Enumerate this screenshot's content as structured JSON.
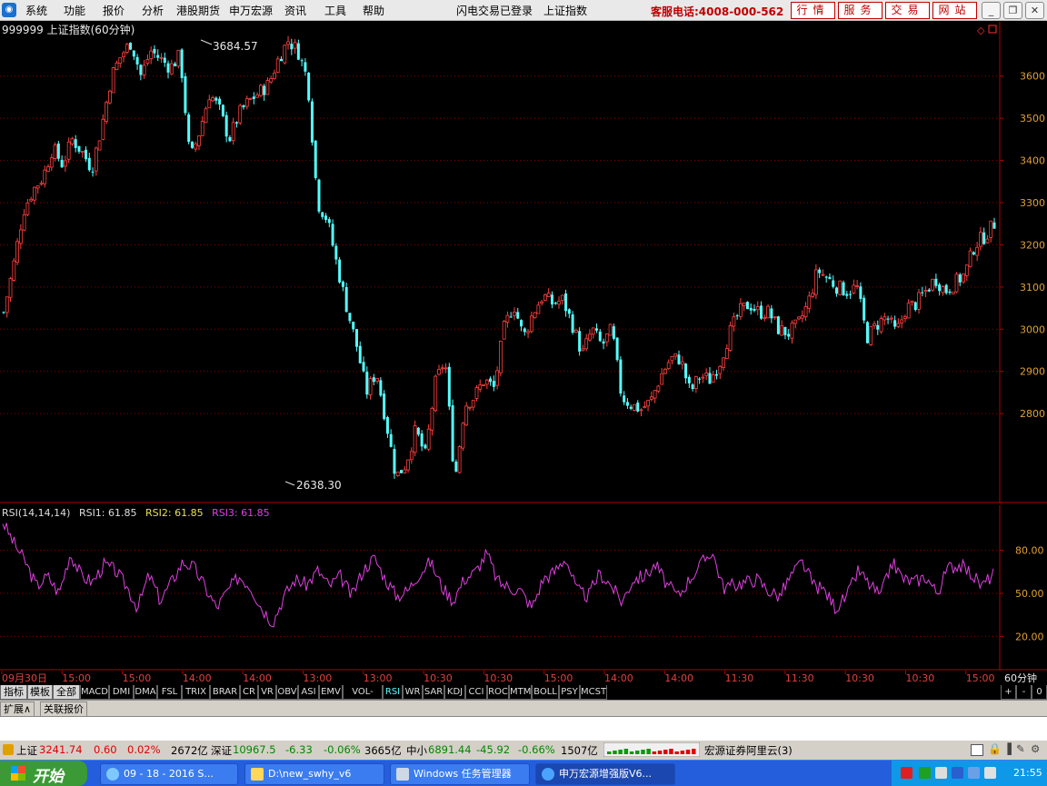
{
  "menubar": {
    "items": [
      "系统",
      "功能",
      "报价",
      "分析",
      "港股期货",
      "申万宏源",
      "资讯",
      "工具",
      "帮助"
    ],
    "status": "闪电交易已登录",
    "current_index": "上证指数",
    "hotline": "客服电话:4008-000-562",
    "buttons": [
      "行情",
      "服务",
      "交易",
      "网站"
    ]
  },
  "main_chart": {
    "title": "999999 上证指数(60分钟)",
    "high_label": "3684.57",
    "low_label": "2638.30",
    "y_ticks": [
      "3600",
      "3500",
      "3400",
      "3300",
      "3200",
      "3100",
      "3000",
      "2900",
      "2800"
    ]
  },
  "rsi": {
    "label": "RSI(14,14,14)",
    "rsi1": "RSI1: 61.85",
    "rsi2": "RSI2: 61.85",
    "rsi3": "RSI3: 61.85",
    "y_ticks": [
      "80.00",
      "50.00",
      "20.00"
    ]
  },
  "time_axis": {
    "labels": [
      "09月30日",
      "15:00",
      "15:00",
      "14:00",
      "14:00",
      "13:00",
      "13:00",
      "10:30",
      "10:30",
      "15:00",
      "14:00",
      "14:00",
      "11:30",
      "11:30",
      "10:30",
      "10:30",
      "15:00"
    ],
    "period": "60分钟"
  },
  "indicator_tabs": [
    "指标",
    "模板",
    "全部",
    "MACD",
    "DMI",
    "DMA",
    "FSL",
    "TRIX",
    "BRAR",
    "CR",
    "VR",
    "OBV",
    "ASI",
    "EMV",
    "VOL-TDX",
    "RSI",
    "WR",
    "SAR",
    "KDJ",
    "CCI",
    "ROC",
    "MTM",
    "BOLL",
    "PSY",
    "MCST"
  ],
  "active_tab": "RSI",
  "tab_controls": [
    "+",
    "-",
    "0"
  ],
  "ext_tabs": [
    "扩展∧",
    "关联报价"
  ],
  "status_bar": {
    "sh_label": "上证",
    "sh_value": "3241.74",
    "sh_change": "0.60",
    "sh_pct": "0.02%",
    "sh_amount": "2672亿",
    "sz_label": "深证",
    "sz_value": "10967.5",
    "sz_change": "-6.33",
    "sz_pct": "-0.06%",
    "sz_amount": "3665亿",
    "zx_label": "中小",
    "zx_value": "6891.44",
    "zx_change": "-45.92",
    "zx_pct": "-0.66%",
    "zx_amount": "1507亿",
    "broker": "宏源证券阿里云(3)"
  },
  "taskbar": {
    "start": "开始",
    "tasks": [
      "09 - 18 - 2016 S...",
      "D:\\new_swhy_v6",
      "Windows 任务管理器",
      "申万宏源增强版V6..."
    ],
    "clock": "21:55"
  },
  "colors": {
    "up": "#ff4040",
    "down": "#54ffff",
    "rsi": "#e040e0",
    "axis": "#b00000",
    "grid": "#8b0000"
  },
  "chart_data": {
    "type": "candlestick",
    "price_scale": {
      "ymin": 2600,
      "ymax": 3720
    },
    "close_path": [
      3040,
      3150,
      3280,
      3330,
      3360,
      3430,
      3390,
      3450,
      3420,
      3380,
      3480,
      3600,
      3650,
      3680,
      3600,
      3660,
      3640,
      3620,
      3650,
      3400,
      3470,
      3560,
      3520,
      3450,
      3510,
      3540,
      3560,
      3580,
      3640,
      3684,
      3660,
      3590,
      3300,
      3260,
      3150,
      3050,
      2960,
      2850,
      2900,
      2780,
      2650,
      2680,
      2760,
      2700,
      2870,
      2930,
      2640,
      2820,
      2840,
      2880,
      2860,
      3000,
      3060,
      2980,
      3040,
      3080,
      3060,
      3070,
      3010,
      2940,
      3000,
      2960,
      3000,
      2840,
      2820,
      2810,
      2830,
      2890,
      2930,
      2930,
      2850,
      2890,
      2880,
      2920,
      2990,
      3040,
      3060,
      3040,
      3040,
      3000,
      2990,
      3010,
      3060,
      3140,
      3120,
      3100,
      3090,
      3100,
      2980,
      3010,
      3030,
      2990,
      3050,
      3060,
      3090,
      3120,
      3090,
      3110,
      3130,
      3200,
      3220,
      3250
    ],
    "rsi_scale": {
      "ymin": 0,
      "ymax": 100
    },
    "rsi_series": [
      100,
      85,
      72,
      55,
      62,
      50,
      78,
      62,
      58,
      70,
      66,
      55,
      40,
      63,
      45,
      58,
      72,
      68,
      54,
      40,
      52,
      62,
      55,
      40,
      30,
      48,
      60,
      56,
      66,
      55,
      62,
      48,
      66,
      75,
      60,
      48,
      52,
      64,
      72,
      55,
      45,
      60,
      65,
      78,
      58,
      54,
      52,
      40,
      60,
      65,
      75,
      52,
      48,
      64,
      56,
      44,
      60,
      62,
      70,
      56,
      48,
      60,
      70,
      80,
      54,
      56,
      58,
      60,
      52,
      48,
      62,
      72,
      56,
      52,
      40,
      48,
      66,
      56,
      48,
      72,
      60,
      58,
      62,
      50,
      68,
      70,
      64,
      55,
      64
    ]
  }
}
